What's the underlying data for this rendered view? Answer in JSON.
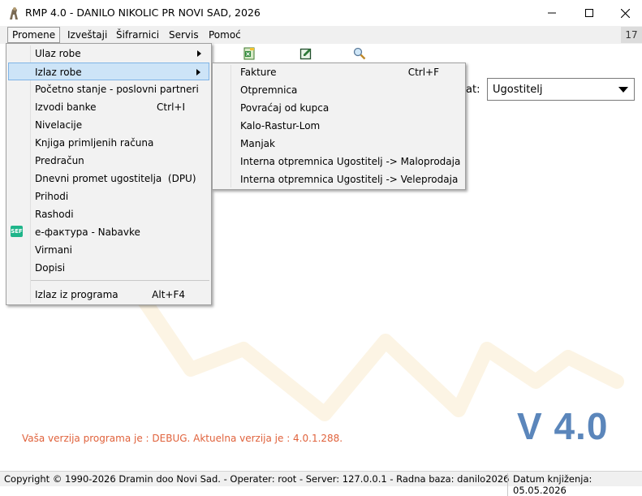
{
  "window": {
    "title": "RMP 4.0 - DANILO NIKOLIC PR NOVI SAD, 2026",
    "controls": [
      "minimize-icon",
      "maximize-icon",
      "close-icon"
    ]
  },
  "menubar": {
    "items": [
      {
        "label": "Promene",
        "open": true
      },
      {
        "label": "Izveštaji"
      },
      {
        "label": "Šifrarnici"
      },
      {
        "label": "Servis"
      },
      {
        "label": "Pomoć"
      }
    ],
    "counter": "17"
  },
  "toolbar": {
    "icons": [
      "excel-icon",
      "notebook-icon",
      "magnifier-icon"
    ]
  },
  "format": {
    "label": "at:",
    "value": "Ugostitelj"
  },
  "promene_menu": {
    "items": [
      {
        "label": "Ulaz robe",
        "submenu": true
      },
      {
        "label": "Izlaz robe",
        "submenu": true,
        "highlighted": true
      },
      {
        "label": "Početno stanje - poslovni partneri"
      },
      {
        "label": "Izvodi banke",
        "shortcut": "Ctrl+I"
      },
      {
        "label": "Nivelacije"
      },
      {
        "label": "Knjiga primljenih računa"
      },
      {
        "label": "Predračun"
      },
      {
        "label": "Dnevni promet ugostitelja  (DPU)"
      },
      {
        "label": "Prihodi"
      },
      {
        "label": "Rashodi"
      },
      {
        "label": "e-фактура - Nabavke",
        "icon": "e-faktura-icon",
        "icon_text": "SEF"
      },
      {
        "label": "Virmani"
      },
      {
        "label": "Dopisi"
      },
      {
        "label": "Izlaz iz programa",
        "shortcut": "Alt+F4"
      }
    ]
  },
  "izlaz_submenu": {
    "items": [
      {
        "label": "Fakture",
        "shortcut": "Ctrl+F"
      },
      {
        "label": "Otpremnica"
      },
      {
        "label": "Povraćaj od kupca"
      },
      {
        "label": "Kalo-Rastur-Lom"
      },
      {
        "label": "Manjak"
      },
      {
        "label": "Interna otpremnica Ugostitelj -> Maloprodaja"
      },
      {
        "label": "Interna otpremnica Ugostitelj -> Veleprodaja"
      }
    ]
  },
  "version": {
    "big": "V 4.0",
    "note": "Vaša verzija programa je : DEBUG. Aktuelna verzija je : 4.0.1.288.",
    "big_color": "#5b86bb",
    "note_color": "#e0623c"
  },
  "statusbar": {
    "left": "Copyright © 1990-2026 Dramin doo Novi Sad. - Operater: root - Server: 127.0.0.1 - Radna baza: danilo2026",
    "right": "Datum knjiženja: 05.05.2026"
  }
}
